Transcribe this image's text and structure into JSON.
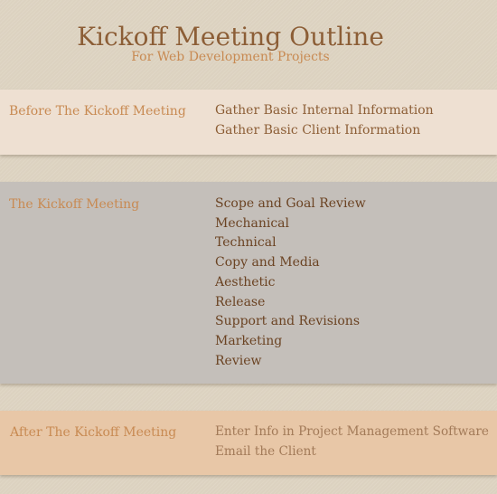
{
  "header": {
    "title": "Kickoff Meeting Outline",
    "subtitle": "For Web Development Projects"
  },
  "colors": {
    "page_background": "#dcd2c0",
    "title": "#8c5e36",
    "accent_label": "#c88a52",
    "before_band": "#eee0d2",
    "during_band": "#c4bfba",
    "after_band": "#e8c7a7"
  },
  "sections": [
    {
      "label": "Before The Kickoff Meeting",
      "items": [
        "Gather Basic Internal Information",
        "Gather Basic Client Information"
      ]
    },
    {
      "label": "The Kickoff Meeting",
      "items": [
        "Scope and Goal Review",
        "Mechanical",
        "Technical",
        "Copy and Media",
        "Aesthetic",
        "Release",
        "Support and Revisions",
        "Marketing",
        "Review"
      ]
    },
    {
      "label": "After The Kickoff Meeting",
      "items": [
        "Enter Info in Project Management Software",
        "Email the Client"
      ]
    }
  ]
}
